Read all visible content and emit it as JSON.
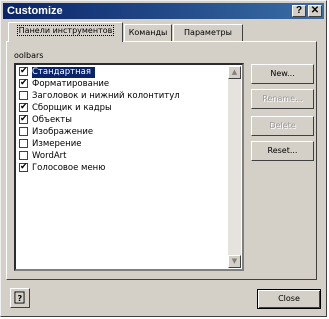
{
  "window": {
    "title": "Customize"
  },
  "caption_buttons": {
    "help": "?",
    "close": "✕"
  },
  "tabs": [
    {
      "label": "Панели инструментов",
      "active": true
    },
    {
      "label": "Команды",
      "active": false
    },
    {
      "label": "Параметры",
      "active": false
    }
  ],
  "list": {
    "label": "oolbars",
    "items": [
      {
        "label": "Стандартная",
        "checked": true,
        "selected": true
      },
      {
        "label": "Форматирование",
        "checked": true,
        "selected": false
      },
      {
        "label": "Заголовок и нижний колонтитул",
        "checked": false,
        "selected": false
      },
      {
        "label": "Сборщик и кадры",
        "checked": true,
        "selected": false
      },
      {
        "label": "Объекты",
        "checked": true,
        "selected": false
      },
      {
        "label": "Изображение",
        "checked": false,
        "selected": false
      },
      {
        "label": "Измерение",
        "checked": false,
        "selected": false
      },
      {
        "label": "WordArt",
        "checked": false,
        "selected": false
      },
      {
        "label": "Голосовое меню",
        "checked": true,
        "selected": false
      }
    ]
  },
  "buttons": {
    "new": "New...",
    "rename": "Rename...",
    "delete": "Delete",
    "reset": "Reset...",
    "close": "Close"
  },
  "icons": {
    "help_button_icon": "help-book-icon",
    "check_mark": "✔",
    "scroll_up": "▲",
    "scroll_down": "▼"
  }
}
